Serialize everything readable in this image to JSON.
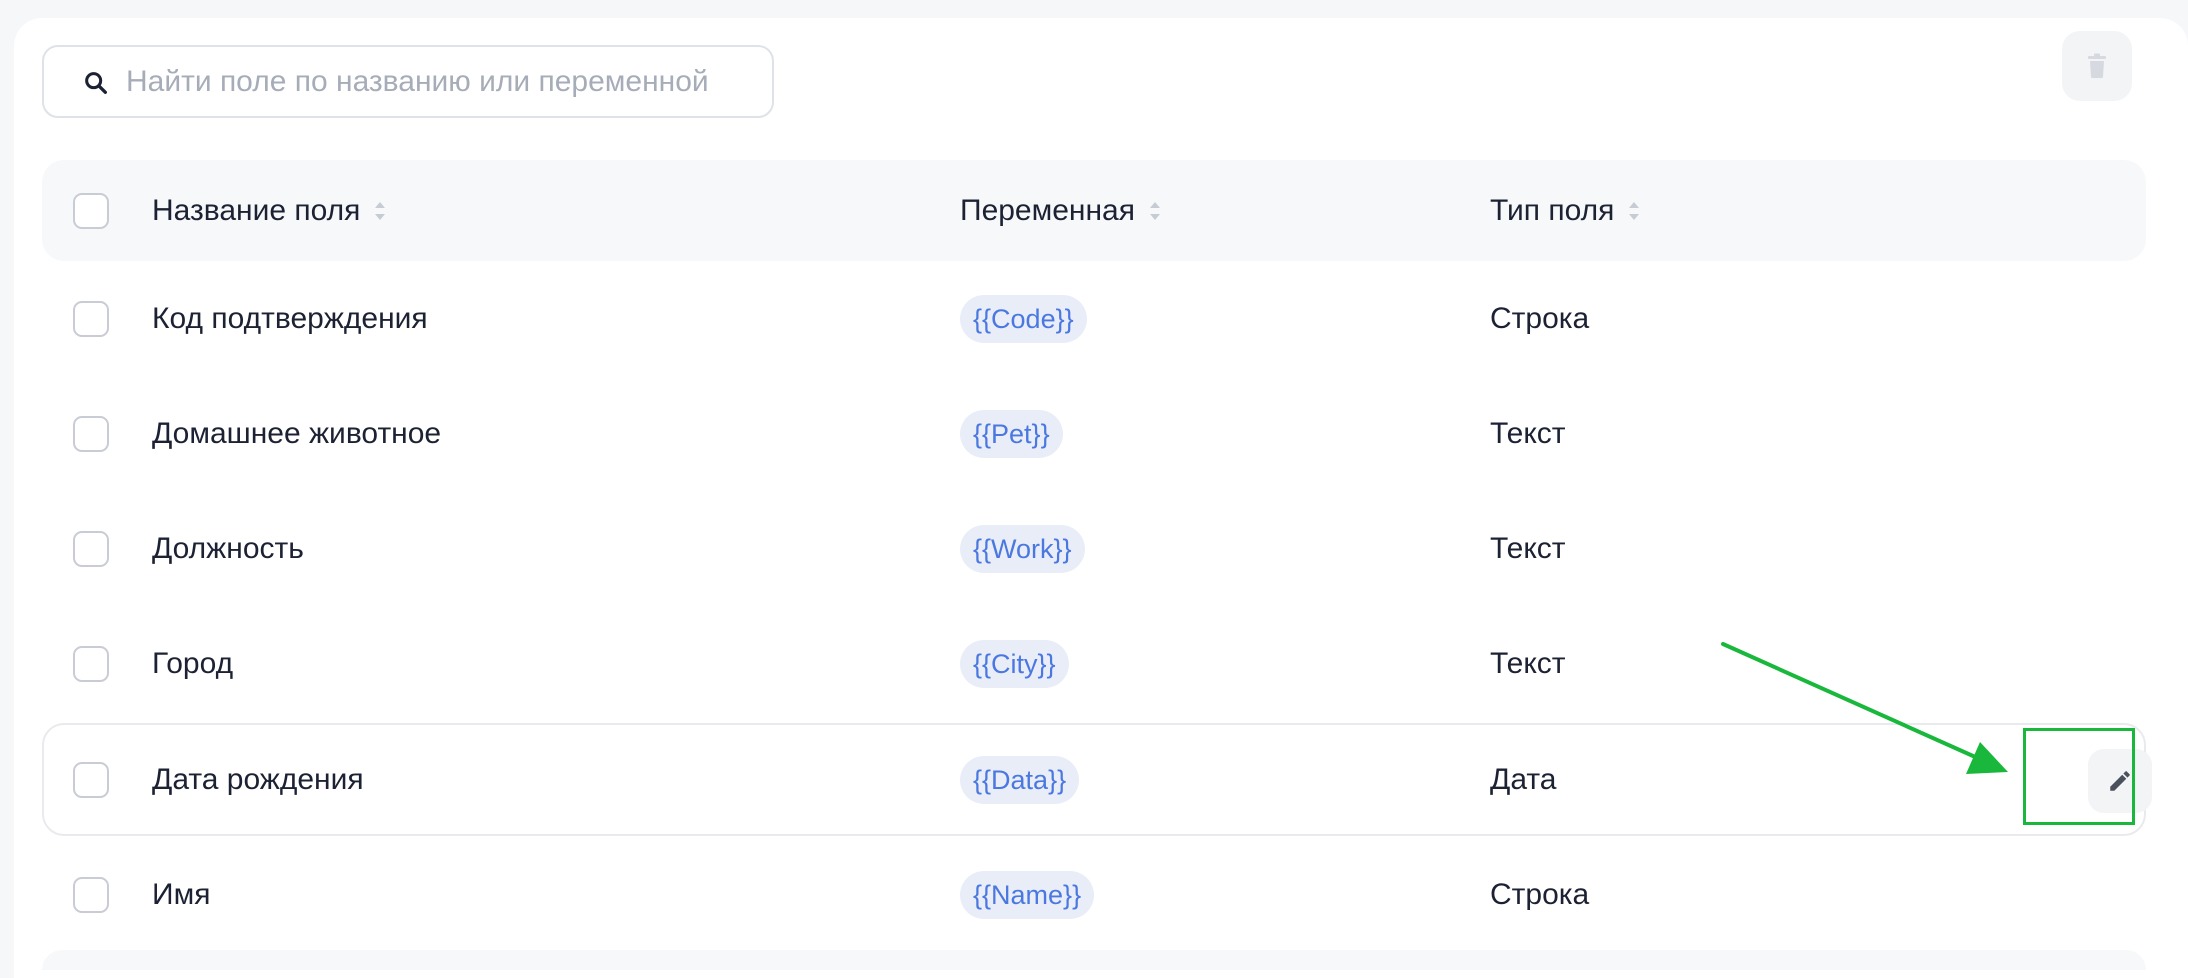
{
  "search": {
    "placeholder": "Найти поле по названию или переменной",
    "value": ""
  },
  "toolbar": {
    "delete_icon": "trash-icon"
  },
  "table": {
    "columns": [
      {
        "label": "Название поля",
        "sortable": true
      },
      {
        "label": "Переменная",
        "sortable": true
      },
      {
        "label": "Тип поля",
        "sortable": true
      }
    ],
    "rows": [
      {
        "name": "Код подтверждения",
        "variable": "{{Code}}",
        "type": "Строка",
        "checked": false
      },
      {
        "name": "Домашнее животное",
        "variable": "{{Pet}}",
        "type": "Текст",
        "checked": false
      },
      {
        "name": "Должность",
        "variable": "{{Work}}",
        "type": "Текст",
        "checked": false
      },
      {
        "name": "Город",
        "variable": "{{City}}",
        "type": "Текст",
        "checked": false
      },
      {
        "name": "Дата рождения",
        "variable": "{{Data}}",
        "type": "Дата",
        "checked": false,
        "hovered": true,
        "row_action_icon": "pencil-icon"
      },
      {
        "name": "Имя",
        "variable": "{{Name}}",
        "type": "Строка",
        "checked": false
      }
    ]
  },
  "colors": {
    "chip_bg": "#e8edf8",
    "chip_text": "#4b78e0",
    "annotation": "#19b83c",
    "header_bg": "#f7f8fa"
  }
}
